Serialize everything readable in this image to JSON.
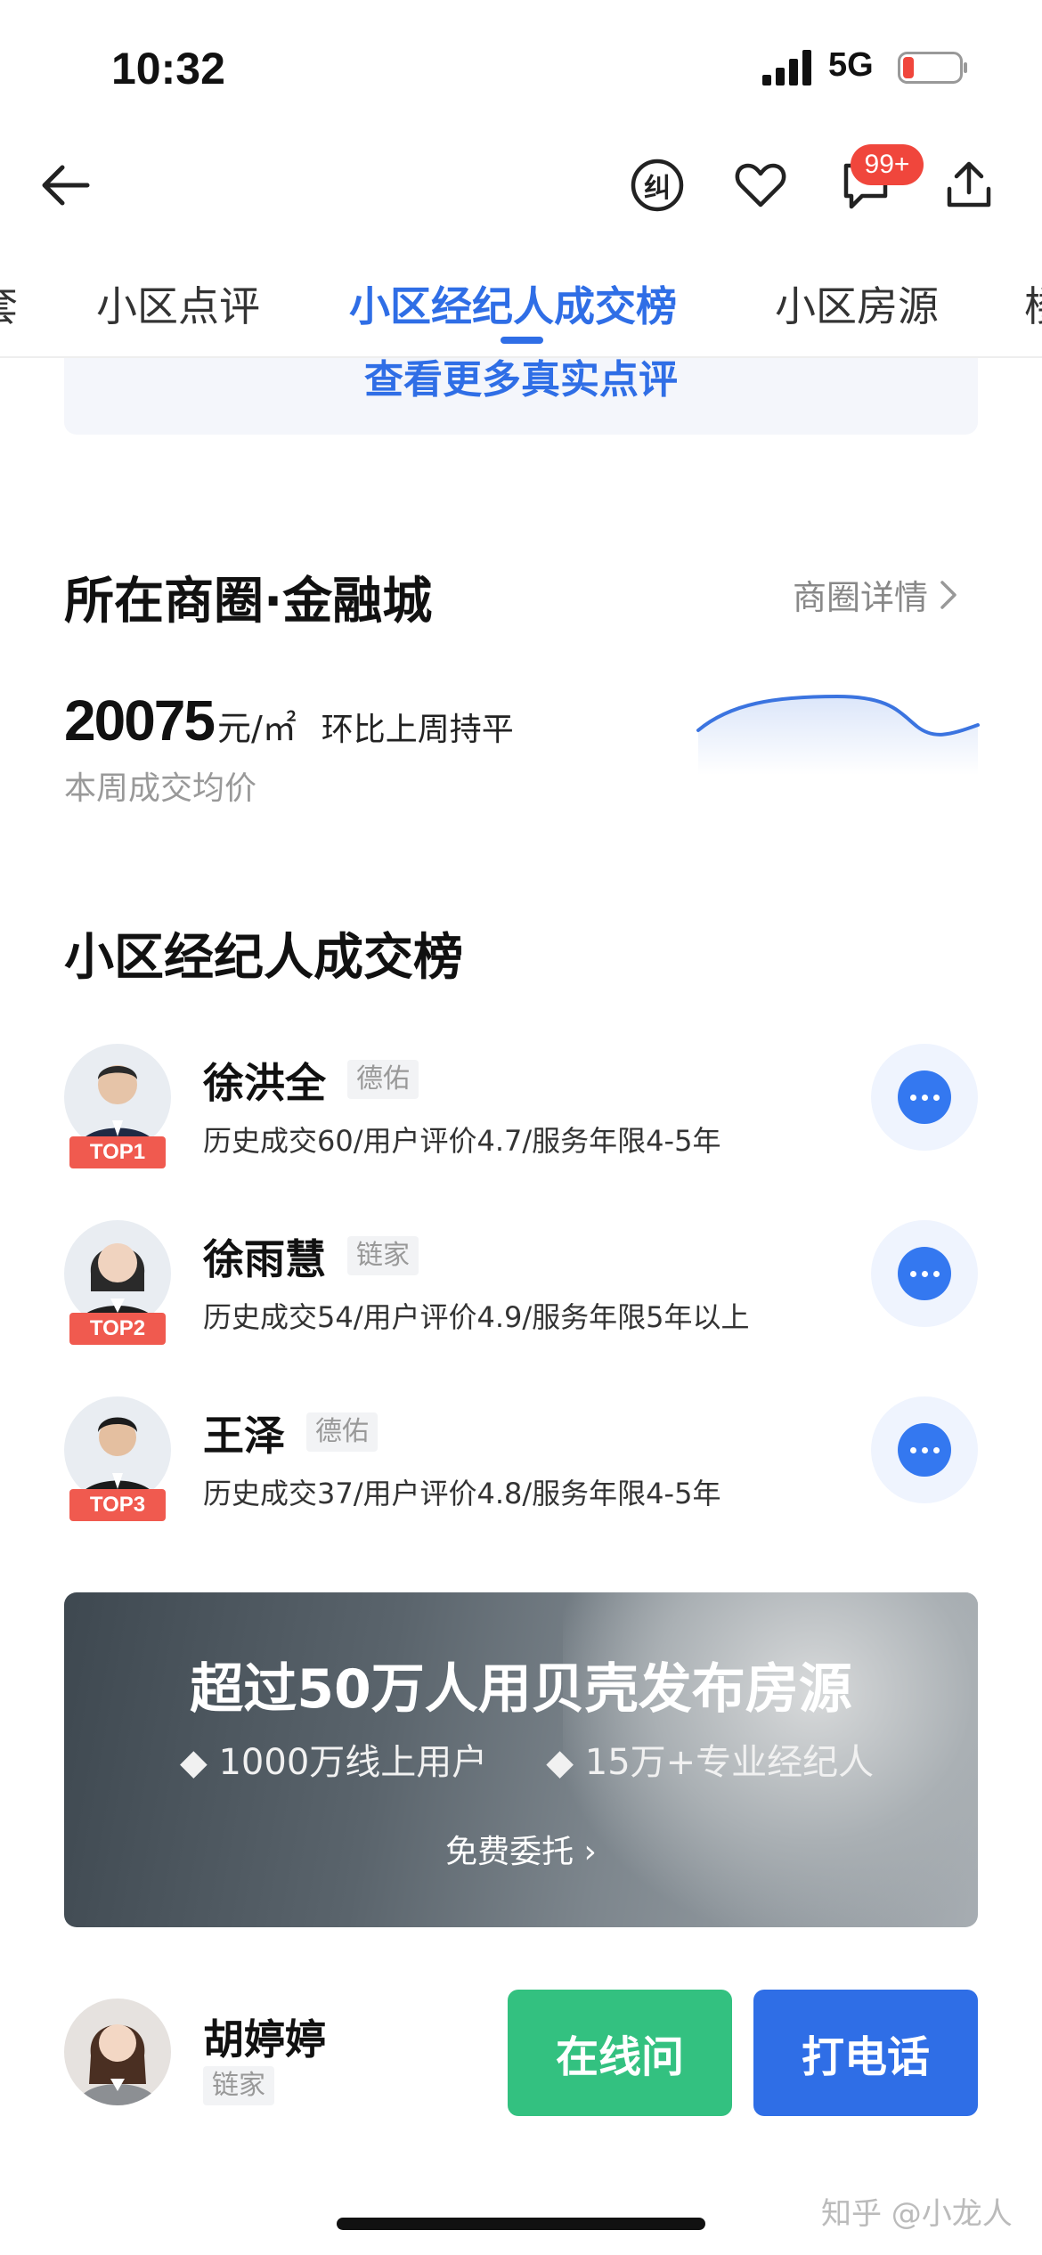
{
  "status_bar": {
    "time": "10:32",
    "network": "5G"
  },
  "nav": {
    "badge": "99+",
    "correct_icon_text": "纠"
  },
  "tabs": [
    {
      "label": "套"
    },
    {
      "label": "小区点评"
    },
    {
      "label": "小区经纪人成交榜"
    },
    {
      "label": "小区房源"
    },
    {
      "label": "楼"
    }
  ],
  "reviews": {
    "more_link": "查看更多真实点评"
  },
  "business_circle": {
    "title": "所在商圈·金融城",
    "detail_link": "商圈详情",
    "price": "20075",
    "unit": "元/㎡",
    "change": "环比上周持平",
    "price_label": "本周成交均价",
    "trend_color": "#3b74e0"
  },
  "ranking": {
    "title": "小区经纪人成交榜",
    "agents": [
      {
        "rank": "TOP1",
        "name": "徐洪全",
        "brand": "德佑",
        "stats": "历史成交60/用户评价4.7/服务年限4-5年"
      },
      {
        "rank": "TOP2",
        "name": "徐雨慧",
        "brand": "链家",
        "stats": "历史成交54/用户评价4.9/服务年限5年以上"
      },
      {
        "rank": "TOP3",
        "name": "王泽",
        "brand": "德佑",
        "stats": "历史成交37/用户评价4.8/服务年限4-5年"
      }
    ]
  },
  "banner": {
    "title": "超过50万人用贝壳发布房源",
    "points": [
      "1000万线上用户",
      "15万+专业经纪人"
    ],
    "button": "免费委托"
  },
  "bottom_bar": {
    "agent_name": "胡婷婷",
    "brand": "链家",
    "online_button": "在线问",
    "call_button": "打电话"
  },
  "watermark": "知乎 @小龙人",
  "colors": {
    "accent": "#2f6ee6",
    "online": "#33c180",
    "badge": "#f0463c",
    "top_tag": "#f05a4f"
  }
}
